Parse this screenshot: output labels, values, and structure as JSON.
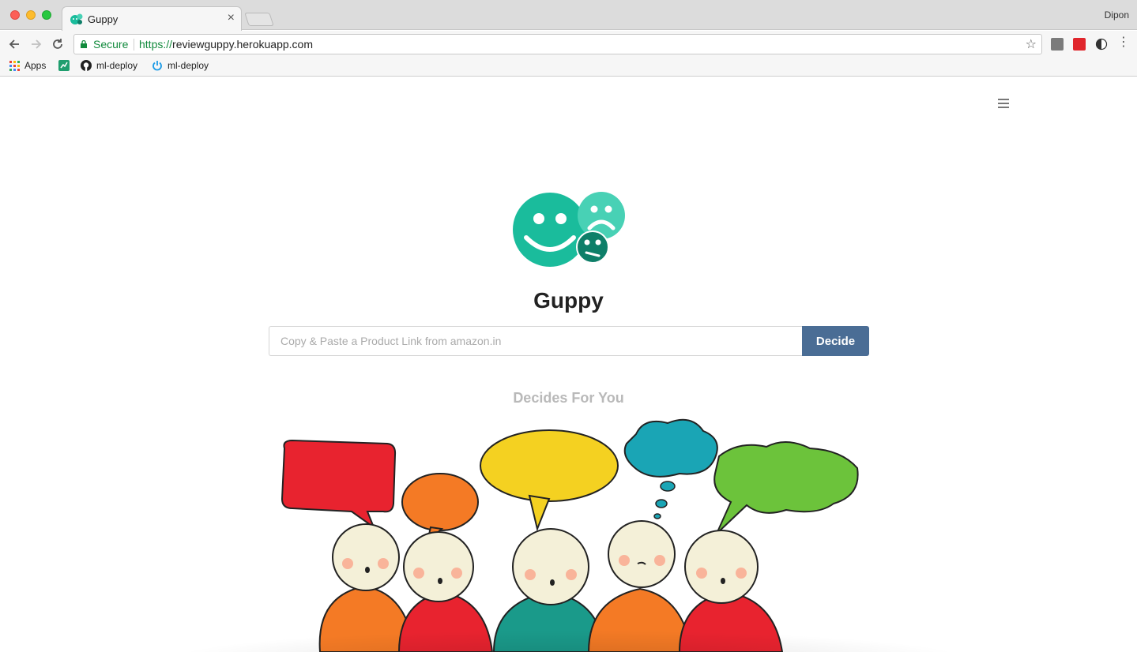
{
  "browser": {
    "tab_title": "Guppy",
    "tab_close": "×",
    "profile_name": "Dipon",
    "secure_label": "Secure",
    "url_scheme": "https://",
    "url_host": "reviewguppy.herokuapp.com",
    "bookmarks": [
      "Apps",
      "ml-deploy",
      "ml-deploy"
    ]
  },
  "page": {
    "brand": "Guppy",
    "search_placeholder": "Copy & Paste a Product Link from amazon.in",
    "decide_label": "Decide",
    "tagline": "Decides For You"
  },
  "colors": {
    "brand_green": "#1abc9c",
    "button_blue": "#4a6d95",
    "secure_green": "#118a3c"
  }
}
